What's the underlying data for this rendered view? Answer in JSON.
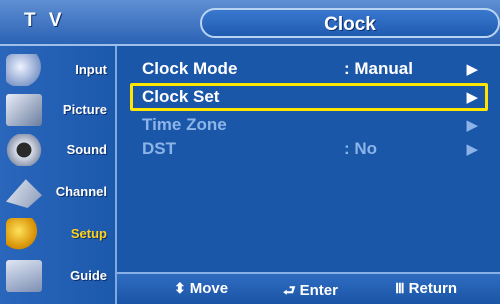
{
  "header": {
    "left_label": "T V",
    "title": "Clock"
  },
  "sidebar": {
    "items": [
      {
        "label": "Input",
        "icon": "input-icon",
        "active": false
      },
      {
        "label": "Picture",
        "icon": "picture-icon",
        "active": false
      },
      {
        "label": "Sound",
        "icon": "sound-icon",
        "active": false
      },
      {
        "label": "Channel",
        "icon": "channel-icon",
        "active": false
      },
      {
        "label": "Setup",
        "icon": "setup-icon",
        "active": true
      },
      {
        "label": "Guide",
        "icon": "guide-icon",
        "active": false
      }
    ]
  },
  "menu": {
    "rows": [
      {
        "label": "Clock Mode",
        "value": ": Manual",
        "arrow": "▶"
      },
      {
        "label": "Clock Set",
        "value": "",
        "arrow": "▶"
      },
      {
        "label": "Time Zone",
        "value": "",
        "arrow": "▶"
      },
      {
        "label": "DST",
        "value": ": No",
        "arrow": "▶"
      }
    ]
  },
  "footer": {
    "move": {
      "icon": "⬍",
      "label": "Move"
    },
    "enter": {
      "icon": "⮐",
      "label": "Enter"
    },
    "return": {
      "icon": "Ⅲ",
      "label": "Return"
    }
  },
  "colors": {
    "background": "#1b57a8",
    "highlight": "#ffe600",
    "active_text": "#ffd21a",
    "dim_text": "#8cb4e8"
  }
}
